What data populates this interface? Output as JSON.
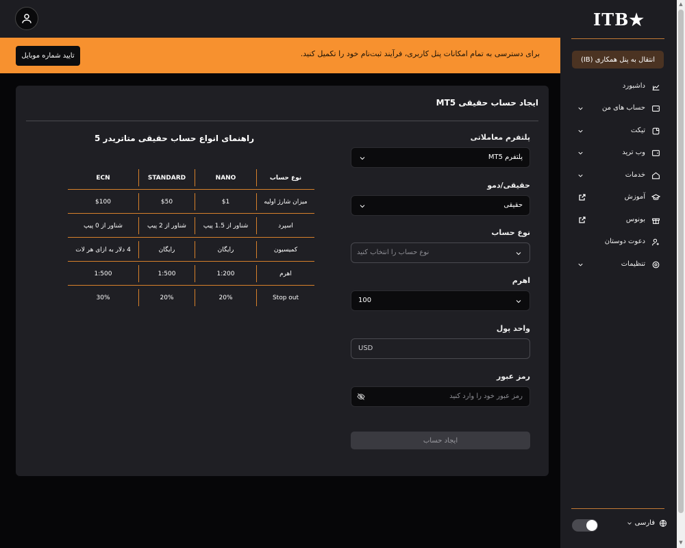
{
  "header": {
    "avatar_icon": "user-icon"
  },
  "banner": {
    "message": "برای دسترسی به تمام امکانات پنل کاربری، فرآیند ثبت‌نام خود را تکمیل کنید.",
    "button_label": "تایید شماره موبایل",
    "color": "#f7912f"
  },
  "card": {
    "title": "ایجاد حساب حقیقی MT5"
  },
  "form": {
    "platform": {
      "label": "پلتفرم معاملاتی",
      "value": "پلتفرم MT5"
    },
    "real_demo": {
      "label": "حقیقی/دمو",
      "value": "حقیقی"
    },
    "account_type": {
      "label": "نوع حساب",
      "placeholder": "نوع حساب را انتخاب کنید"
    },
    "leverage": {
      "label": "اهرم",
      "value": "100"
    },
    "currency": {
      "label": "واحد پول",
      "value": "USD"
    },
    "password": {
      "label": "رمز عبور",
      "placeholder": "رمز عبور خود را وارد کنید"
    },
    "submit_label": "ایجاد حساب"
  },
  "guide": {
    "title": "راهنمای انواع حساب حقیقی متاتریدر 5",
    "headers": [
      "نوع حساب",
      "NANO",
      "STANDARD",
      "ECN"
    ],
    "rows": [
      [
        "میزان شارژ اولیه",
        "$1",
        "$50",
        "$100"
      ],
      [
        "اسپرد",
        "شناور از 1.5 پیپ",
        "شناور از 2 پیپ",
        "شناور از 0 پیپ"
      ],
      [
        "کمیسیون",
        "رایگان",
        "رایگان",
        "4 دلار به ازای هر لات"
      ],
      [
        "اهرم",
        "1:200",
        "1:500",
        "1:500"
      ],
      [
        "Stop out",
        "20%",
        "20%",
        "30%"
      ]
    ]
  },
  "sidebar": {
    "logo": "ITB★",
    "ib_button": "انتقال به پنل همکاری (IB)",
    "items": [
      {
        "label": "داشبورد",
        "icon": "chart-icon"
      },
      {
        "label": "حساب های من",
        "icon": "wallet-icon"
      },
      {
        "label": "تیکت",
        "icon": "ticket-icon"
      },
      {
        "label": "وب ترید",
        "icon": "webtrade-icon"
      },
      {
        "label": "خدمات",
        "icon": "home-icon"
      },
      {
        "label": "آموزش",
        "icon": "graduation-icon"
      },
      {
        "label": "بونوس",
        "icon": "gift-icon"
      },
      {
        "label": "دعوت دوستان",
        "icon": "user-plus-icon"
      },
      {
        "label": "تنظیمات",
        "icon": "gear-icon"
      }
    ],
    "language": "فارسی",
    "accent": "#c47a35"
  }
}
